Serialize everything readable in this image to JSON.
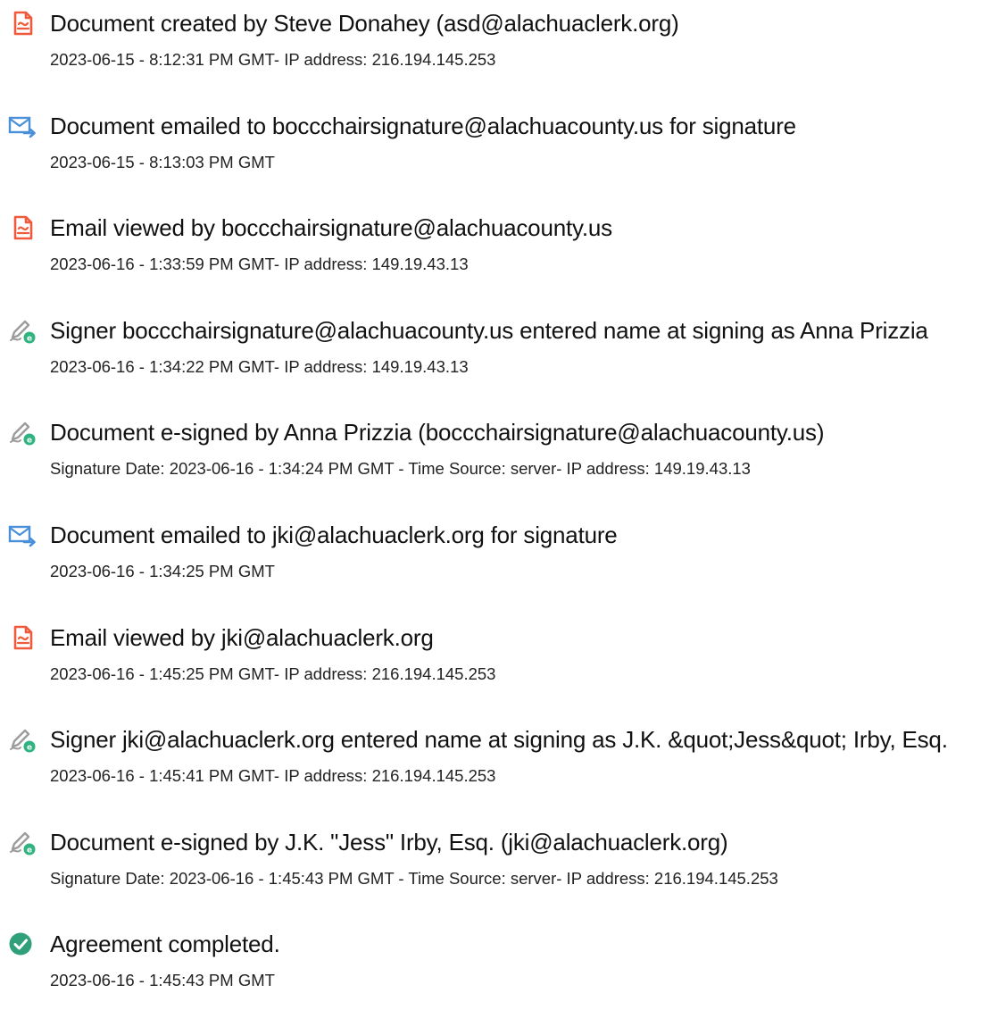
{
  "entries": [
    {
      "icon": "document-created-icon",
      "title": "Document created by Steve Donahey (asd@alachuaclerk.org)",
      "detail": "2023-06-15 - 8:12:31 PM GMT- IP address: 216.194.145.253"
    },
    {
      "icon": "email-sent-icon",
      "title": "Document emailed to boccchairsignature@alachuacounty.us for signature",
      "detail": "2023-06-15 - 8:13:03 PM GMT"
    },
    {
      "icon": "document-viewed-icon",
      "title": "Email viewed by boccchairsignature@alachuacounty.us",
      "detail": "2023-06-16 - 1:33:59 PM GMT- IP address: 149.19.43.13"
    },
    {
      "icon": "pen-sign-icon",
      "title": "Signer boccchairsignature@alachuacounty.us entered name at signing as Anna Prizzia",
      "detail": "2023-06-16 - 1:34:22 PM GMT- IP address: 149.19.43.13"
    },
    {
      "icon": "pen-sign-icon",
      "title": "Document e-signed by Anna Prizzia (boccchairsignature@alachuacounty.us)",
      "detail": "Signature Date: 2023-06-16 - 1:34:24 PM GMT - Time Source: server- IP address: 149.19.43.13"
    },
    {
      "icon": "email-sent-icon",
      "title": "Document emailed to jki@alachuaclerk.org for signature",
      "detail": "2023-06-16 - 1:34:25 PM GMT"
    },
    {
      "icon": "document-viewed-icon",
      "title": "Email viewed by jki@alachuaclerk.org",
      "detail": "2023-06-16 - 1:45:25 PM GMT- IP address: 216.194.145.253"
    },
    {
      "icon": "pen-sign-icon",
      "title": "Signer jki@alachuaclerk.org entered name at signing as J.K. &quot;Jess&quot; Irby, Esq.",
      "detail": "2023-06-16 - 1:45:41 PM GMT- IP address: 216.194.145.253"
    },
    {
      "icon": "pen-sign-icon",
      "title": "Document e-signed by J.K. \"Jess\" Irby, Esq. (jki@alachuaclerk.org)",
      "detail": "Signature Date: 2023-06-16 - 1:45:43 PM GMT - Time Source: server- IP address: 216.194.145.253"
    },
    {
      "icon": "check-circle-icon",
      "title": "Agreement completed.",
      "detail": "2023-06-16 - 1:45:43 PM GMT"
    }
  ],
  "colors": {
    "document_icon": "#f05a3c",
    "email_icon": "#4a90d9",
    "pen_icon": "#9c9c9c",
    "pen_badge": "#2fb37f",
    "check_icon": "#2fa07a"
  }
}
